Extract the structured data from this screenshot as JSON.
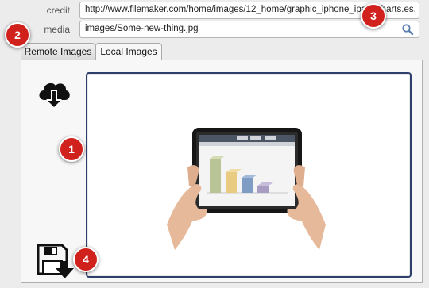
{
  "fields": {
    "credit": {
      "label": "credit",
      "value": "http://www.filemaker.com/home/images/12_home/graphic_iphone_ipad_charts.es."
    },
    "media": {
      "label": "media",
      "value": "images/Some-new-thing.jpg"
    }
  },
  "tabs": [
    {
      "label": "Remote Images",
      "active": false
    },
    {
      "label": "Local Images",
      "active": true
    }
  ],
  "callouts": [
    "1",
    "2",
    "3",
    "4"
  ],
  "icons": {
    "download": "cloud-download-icon",
    "save": "save-download-icon",
    "search": "search-icon"
  },
  "colors": {
    "callout": "#d0211c",
    "frame_border": "#2d3f6a"
  }
}
